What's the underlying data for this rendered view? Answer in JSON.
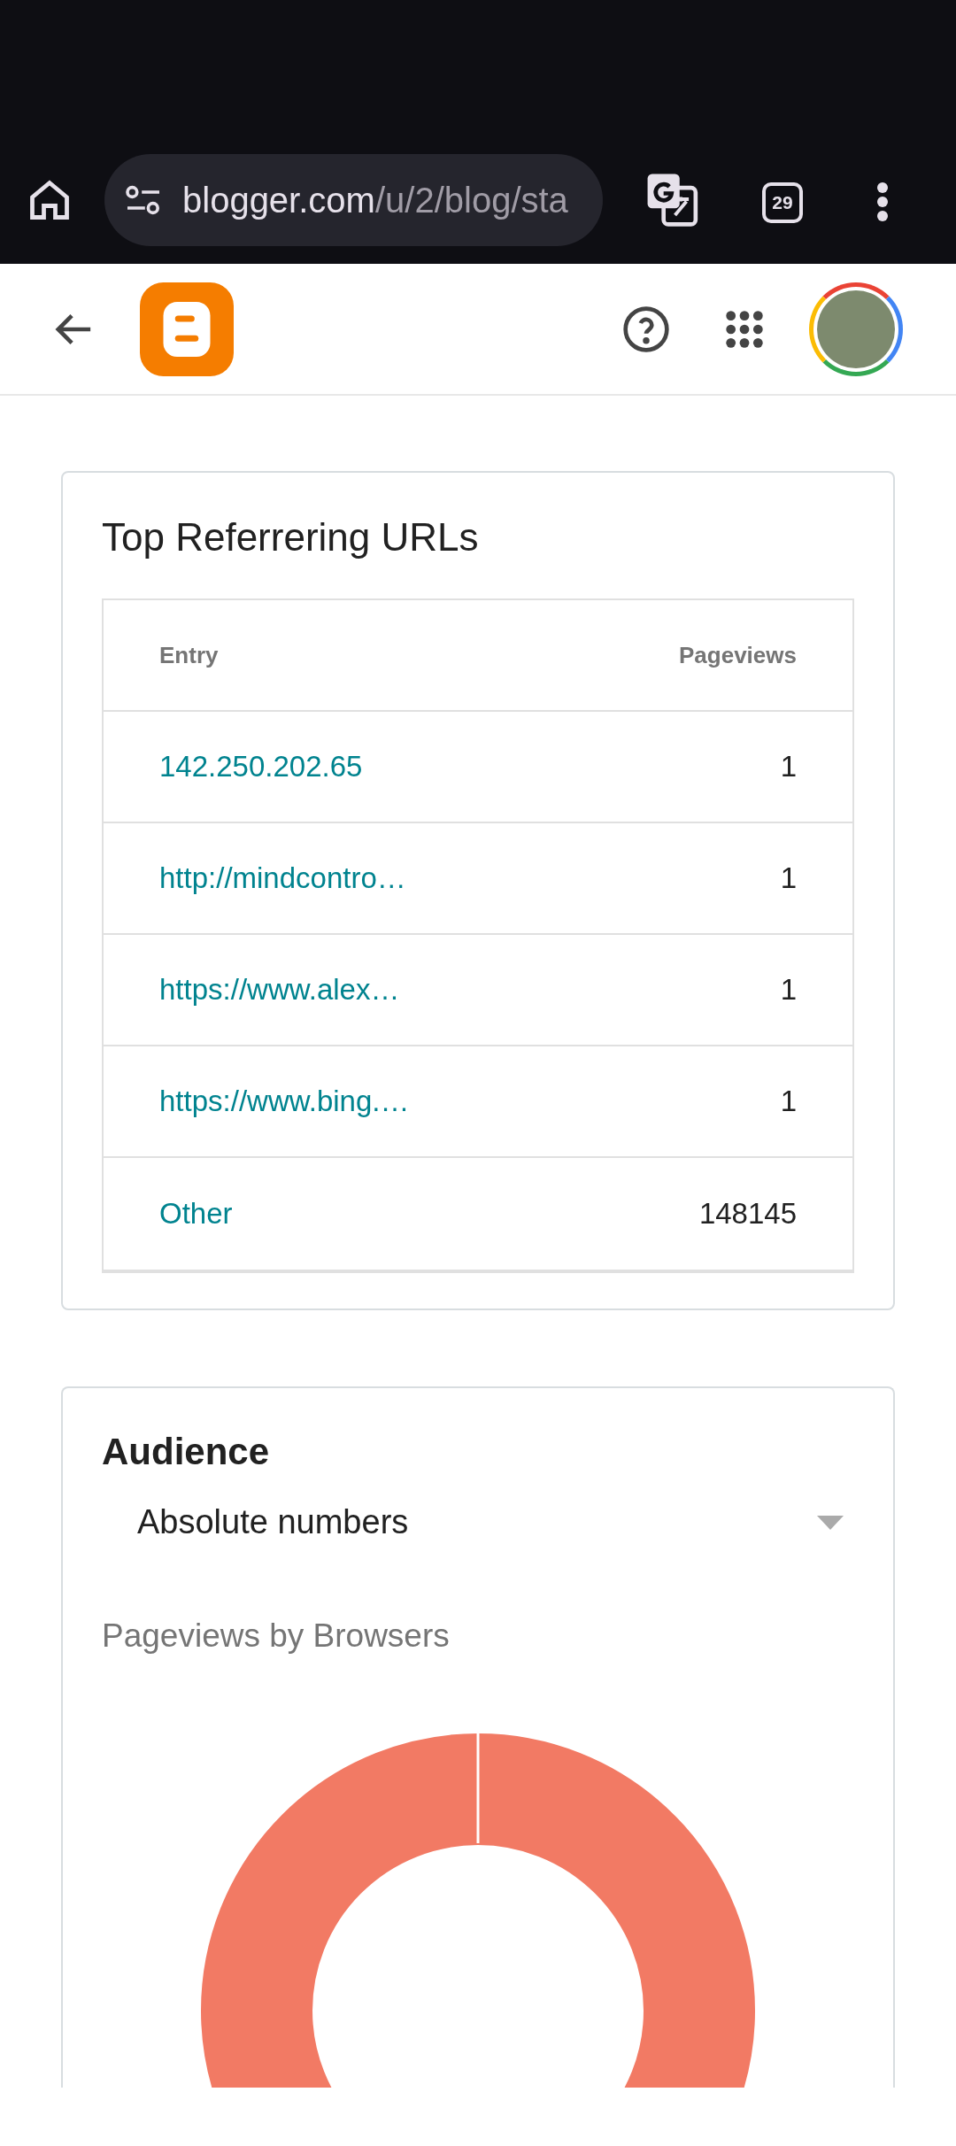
{
  "browser": {
    "url_host": "blogger.com",
    "url_path": "/u/2/blog/sta",
    "tab_count": "29"
  },
  "referrers": {
    "title": "Top Referrering URLs",
    "columns": [
      "Entry",
      "Pageviews"
    ],
    "rows": [
      {
        "entry": "142.250.202.65",
        "pageviews": "1"
      },
      {
        "entry": "http://mindcontro…",
        "pageviews": "1"
      },
      {
        "entry": "https://www.alex…",
        "pageviews": "1"
      },
      {
        "entry": "https://www.bing.…",
        "pageviews": "1"
      },
      {
        "entry": "Other",
        "pageviews": "148145"
      }
    ]
  },
  "audience": {
    "title": "Audience",
    "mode": "Absolute numbers",
    "chart_title": "Pageviews by Browsers"
  }
}
